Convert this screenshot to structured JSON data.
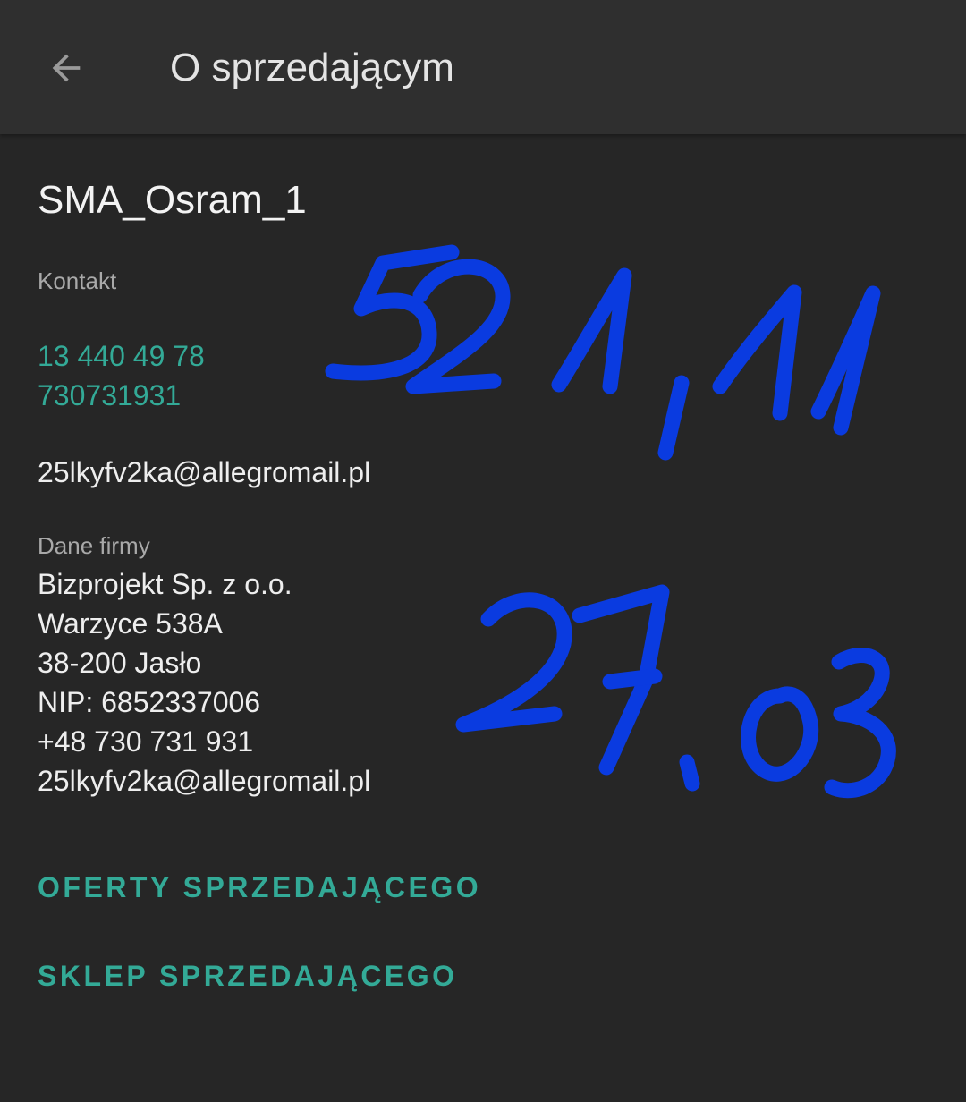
{
  "appbar": {
    "back_icon": "arrow-left-icon",
    "title": "O sprzedającym"
  },
  "seller": {
    "name": "SMA_Osram_1",
    "contact_label": "Kontakt",
    "phones": [
      "13 440 49 78",
      "730731931"
    ],
    "email": "25lkyfv2ka@allegromail.pl"
  },
  "company": {
    "label": "Dane firmy",
    "lines": [
      "Bizprojekt Sp. z o.o.",
      "Warzyce 538A",
      "38-200 Jasło",
      "NIP: 6852337006",
      "+48 730 731 931",
      "25lkyfv2ka@allegromail.pl"
    ]
  },
  "actions": {
    "offers_label": "OFERTY SPRZEDAJĄCEGO",
    "shop_label": "SKLEP SPRZEDAJĄCEGO"
  },
  "annotations": {
    "amount": "521,11",
    "date": "27.03",
    "ink_color": "#0a3be0"
  },
  "colors": {
    "background": "#262626",
    "appbar": "#2f2f2f",
    "accent": "#33aa97",
    "text": "#eeeeee",
    "muted": "#a9a9a9"
  }
}
